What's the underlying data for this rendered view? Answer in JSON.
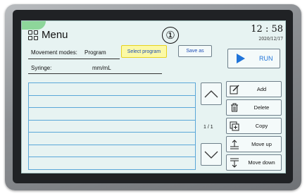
{
  "header": {
    "title": "Menu",
    "icon": "menu-grid-icon",
    "time": "12 : 58",
    "date": "2020/12/17"
  },
  "callout": "①",
  "movement": {
    "label": "Movement modes:",
    "value": "Program",
    "select_label": "Select program",
    "save_label": "Save as"
  },
  "syringe": {
    "label": "Syringe:",
    "unit": "mm/mL"
  },
  "run": {
    "label": "RUN",
    "color": "#1f74d9"
  },
  "list": {
    "rows": [
      "",
      "",
      "",
      "",
      "",
      "",
      ""
    ]
  },
  "pager": {
    "text": "1 / 1"
  },
  "actions": [
    {
      "label": "Add",
      "icon": "pencil-icon"
    },
    {
      "label": "Delete",
      "icon": "trash-icon"
    },
    {
      "label": "Copy",
      "icon": "copy-icon"
    },
    {
      "label": "Move up",
      "icon": "move-up-icon"
    },
    {
      "label": "Move down",
      "icon": "move-down-icon"
    }
  ]
}
